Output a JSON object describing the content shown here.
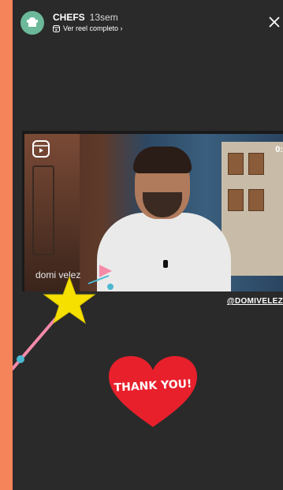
{
  "header": {
    "account_name": "CHEFS",
    "posted_ago": "13sem",
    "reel_link": "Ver reel completo ›"
  },
  "video": {
    "time_label": "0:",
    "name_tag": "domi velez"
  },
  "mention": "@DOMIVELEZ",
  "sticker": {
    "text": "THANK YOU!"
  },
  "icons": {
    "avatar": "chef-hat-icon",
    "reel": "reel-icon",
    "close": "close-icon",
    "reels_overlay": "reels-icon",
    "heart": "heart-icon",
    "star": "star-icon"
  },
  "colors": {
    "page_bg": "#f5845a",
    "story_bg": "#2a2a2a",
    "heart": "#e8202c",
    "star": "#f5e000",
    "wand": "#f48aa8"
  }
}
